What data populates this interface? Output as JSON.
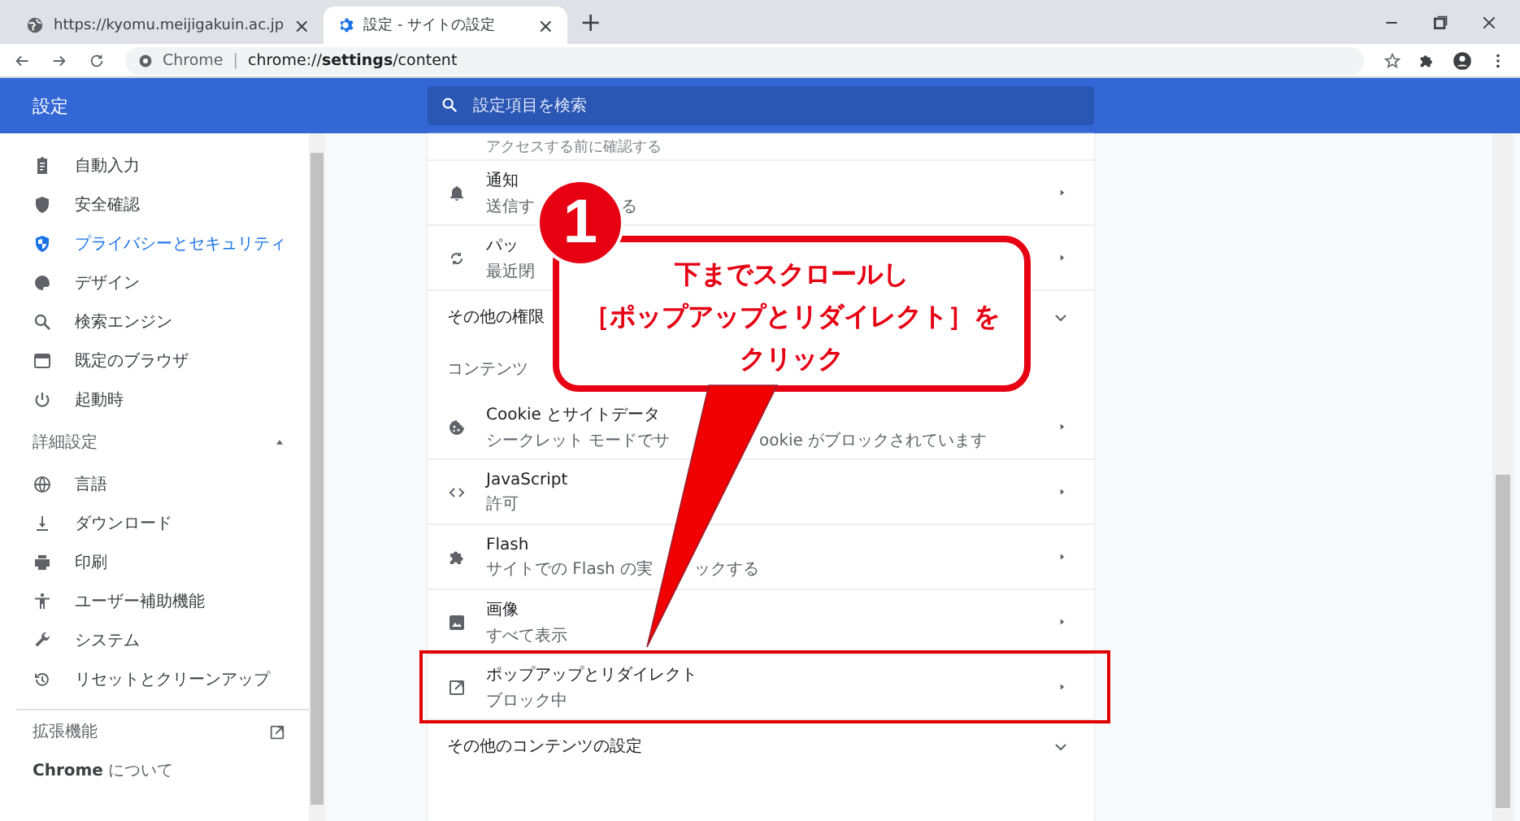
{
  "tabs": [
    {
      "title": "https://kyomu.meijigakuin.ac.jp",
      "close": "×",
      "selected": false
    },
    {
      "title": "設定 - サイトの設定",
      "close": "×",
      "selected": true
    }
  ],
  "new_tab": "+",
  "address": {
    "origin": "Chrome",
    "separator": "|",
    "url": "chrome://**settings**/content"
  },
  "header": {
    "title": "設定",
    "search_placeholder": "設定項目を検索"
  },
  "sidebar": {
    "items": [
      {
        "label": "自動入力",
        "selected": false
      },
      {
        "label": "安全確認",
        "selected": false
      },
      {
        "label": "プライバシーとセキュリティ",
        "selected": true
      },
      {
        "label": "デザイン",
        "selected": false
      },
      {
        "label": "検索エンジン",
        "selected": false
      },
      {
        "label": "既定のブラウザ",
        "selected": false
      },
      {
        "label": "起動時",
        "selected": false
      }
    ],
    "advanced": {
      "label": "詳細設定",
      "expanded": true,
      "items": [
        {
          "label": "言語",
          "selected": false
        },
        {
          "label": "ダウンロード",
          "selected": false
        },
        {
          "label": "印刷",
          "selected": false
        },
        {
          "label": "ユーザー補助機能",
          "selected": false
        },
        {
          "label": "システム",
          "selected": false
        },
        {
          "label": "リセットとクリーンアップ",
          "selected": false
        }
      ]
    },
    "extensions": "拡張機能",
    "about": "**Chrome** について"
  },
  "main": {
    "top_partial": "アクセスする前に確認する",
    "permissions": [
      {
        "title": "通知",
        "subtitle_parts": [
          "送信す",
          "る"
        ],
        "highlighted": false
      },
      {
        "title": "パッ",
        "subtitle_parts": [
          "最近閉"
        ],
        "highlighted": false
      }
    ],
    "other_permissions": {
      "label": "その他の権限",
      "expanded": false
    },
    "content_heading": "コンテンツ",
    "content": [
      {
        "title": "Cookie とサイトデータ",
        "subtitle_parts": [
          "シークレット モードでサ",
          "ookie がブロックされています"
        ],
        "highlighted": false
      },
      {
        "title": "JavaScript",
        "subtitle_parts": [
          "許可"
        ],
        "highlighted": false
      },
      {
        "title": "Flash",
        "subtitle_parts": [
          "サイトでの Flash の実",
          "ックする"
        ],
        "highlighted": false
      },
      {
        "title": "画像",
        "subtitle_parts": [
          "すべて表示"
        ],
        "highlighted": false
      },
      {
        "title": "ポップアップとリダイレクト",
        "subtitle_parts": [
          "ブロック中"
        ],
        "highlighted": true
      }
    ],
    "more_content": {
      "label": "その他のコンテンツの設定",
      "expanded": false
    }
  },
  "callout": {
    "number": "1",
    "lines": [
      "下までスクロールし",
      "［ポップアップとリダイレクト］を",
      "クリック"
    ]
  }
}
